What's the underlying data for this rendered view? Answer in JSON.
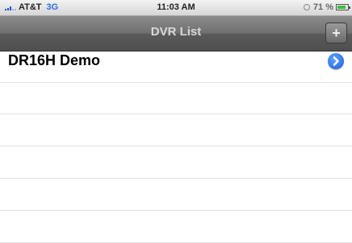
{
  "status_bar": {
    "carrier": "AT&T",
    "network": "3G",
    "time": "11:03 AM",
    "battery": "71 %"
  },
  "nav_bar": {
    "title": "DVR List",
    "add_label": "+"
  },
  "list": {
    "rows": [
      {
        "title": "DR16H Demo",
        "accessory": "detail-disclosure-icon"
      },
      {
        "title": ""
      },
      {
        "title": ""
      },
      {
        "title": ""
      },
      {
        "title": ""
      },
      {
        "title": ""
      }
    ]
  }
}
